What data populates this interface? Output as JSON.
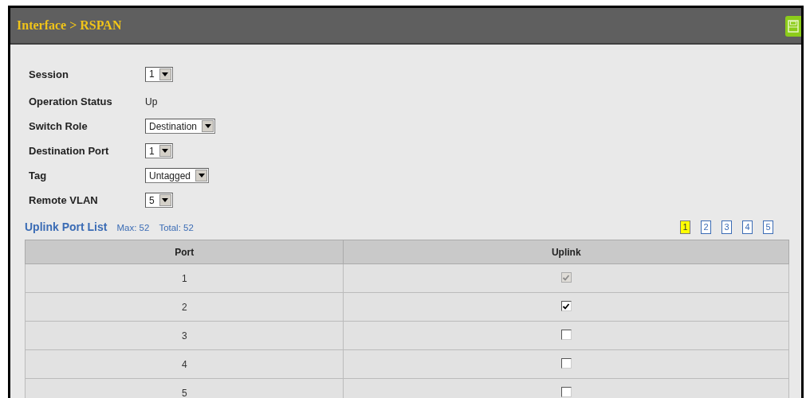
{
  "header": {
    "title": "Interface > RSPAN"
  },
  "fields": [
    {
      "kind": "select",
      "label": "Session",
      "value": "1"
    },
    {
      "kind": "text",
      "label": "Operation Status",
      "value": "Up"
    },
    {
      "kind": "select",
      "label": "Switch Role",
      "value": "Destination"
    },
    {
      "kind": "select",
      "label": "Destination Port",
      "value": "1"
    },
    {
      "kind": "select",
      "label": "Tag",
      "value": "Untagged"
    },
    {
      "kind": "select",
      "label": "Remote VLAN",
      "value": "5"
    }
  ],
  "list": {
    "title": "Uplink Port List",
    "max": "Max: 52",
    "total": "Total: 52",
    "pages": [
      {
        "label": "1",
        "selected": true
      },
      {
        "label": "2",
        "selected": false
      },
      {
        "label": "3",
        "selected": false
      },
      {
        "label": "4",
        "selected": false
      },
      {
        "label": "5",
        "selected": false
      }
    ],
    "columns": [
      "Port",
      "Uplink"
    ],
    "rows": [
      {
        "port": "1",
        "checked": true,
        "disabled": true
      },
      {
        "port": "2",
        "checked": true,
        "disabled": false
      },
      {
        "port": "3",
        "checked": false,
        "disabled": false
      },
      {
        "port": "4",
        "checked": false,
        "disabled": false
      },
      {
        "port": "5",
        "checked": false,
        "disabled": false
      }
    ]
  }
}
